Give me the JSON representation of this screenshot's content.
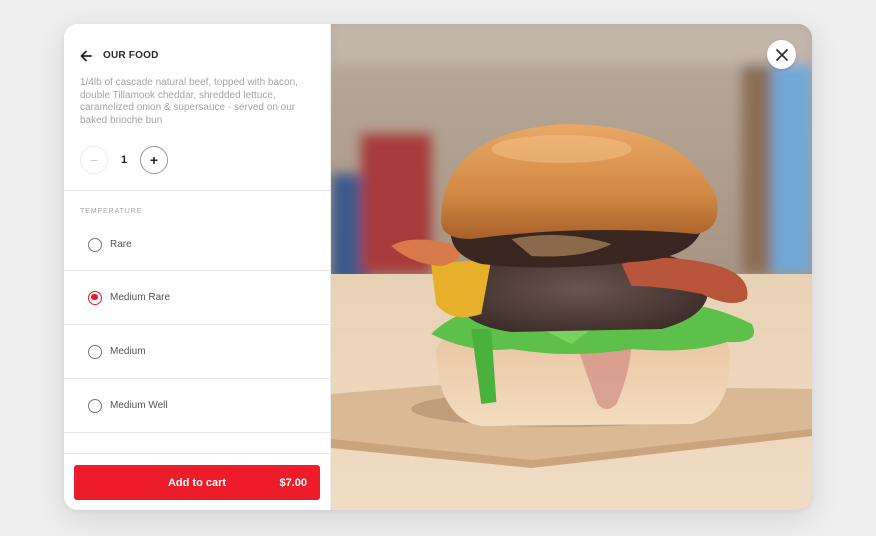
{
  "header": {
    "back_icon": "arrow-left-icon",
    "title": "OUR FOOD"
  },
  "item": {
    "description": "1/4lb of cascade natural beef, topped with bacon, double Tillamook cheddar, shredded lettuce, caramelized onion & supersauce - served on our baked brioche bun",
    "image_alt": "Burger with bacon, cheddar, lettuce and caramelized onion on brioche bun"
  },
  "quantity": {
    "value": "1",
    "minus_label": "−",
    "plus_label": "+",
    "minus_disabled": true
  },
  "temperature": {
    "label": "TEMPERATURE",
    "selected": "Medium Rare",
    "options": [
      {
        "label": "Rare",
        "checked": false
      },
      {
        "label": "Medium Rare",
        "checked": true
      },
      {
        "label": "Medium",
        "checked": false
      },
      {
        "label": "Medium Well",
        "checked": false
      }
    ]
  },
  "footer": {
    "add_to_cart_label": "Add to cart",
    "price": "$7.00"
  },
  "close_icon": "close-icon",
  "colors": {
    "accent": "#ec1c2a",
    "background": "#eeeeef",
    "text_muted": "#a4a4a8"
  }
}
